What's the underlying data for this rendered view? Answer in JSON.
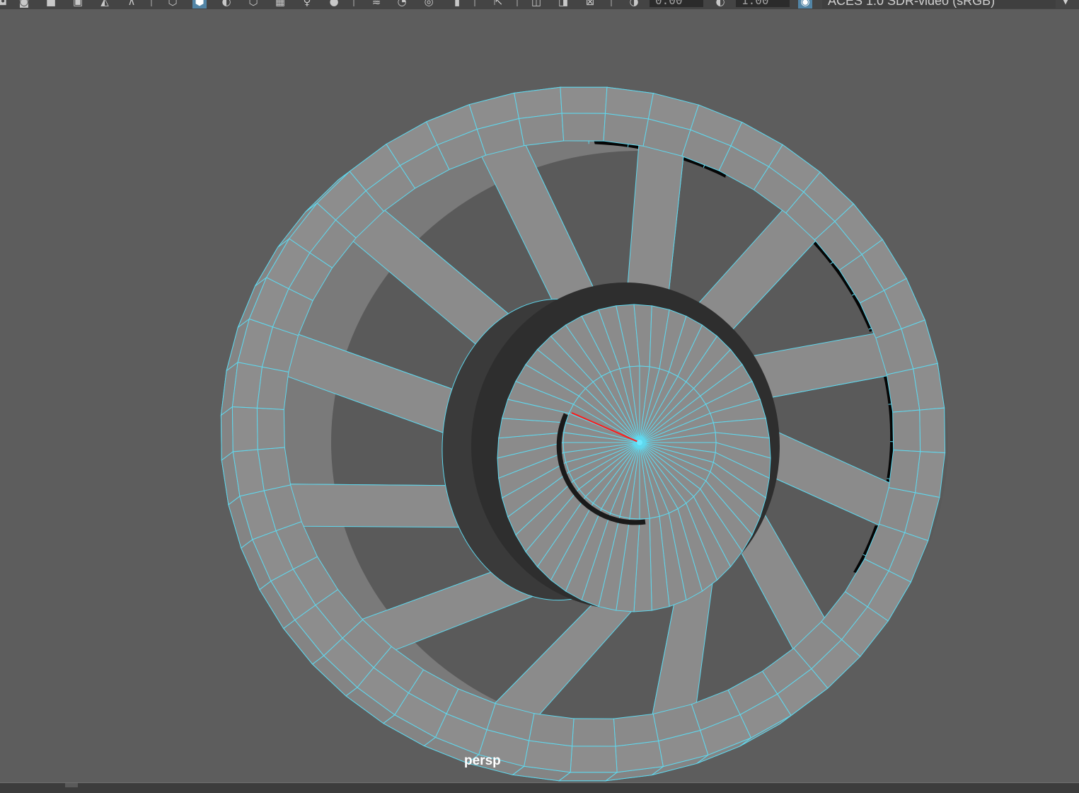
{
  "toolbar": {
    "icons": [
      {
        "name": "select-camera-icon",
        "glyph": "◘",
        "active": false
      },
      {
        "name": "camera-attributes-icon",
        "glyph": "◙",
        "active": false
      },
      {
        "name": "image-plane-icon",
        "glyph": "■",
        "active": false
      },
      {
        "name": "bookmark-icon",
        "glyph": "▣",
        "active": false
      },
      {
        "name": "2d-pan-zoom-icon",
        "glyph": "◭",
        "active": false
      },
      {
        "name": "grease-pencil-icon",
        "glyph": "⊼",
        "active": false
      },
      {
        "name": "wireframe-icon",
        "glyph": "⬡",
        "active": false
      },
      {
        "name": "smooth-shade-icon",
        "glyph": "⬢",
        "active": true
      },
      {
        "name": "default-material-icon",
        "glyph": "◐",
        "active": false
      },
      {
        "name": "wireframe-on-shaded-icon",
        "glyph": "⬡",
        "active": false
      },
      {
        "name": "textured-icon",
        "glyph": "▦",
        "active": false
      },
      {
        "name": "use-all-lights-icon",
        "glyph": "♀",
        "active": false
      },
      {
        "name": "shadows-icon",
        "glyph": "●",
        "active": false
      },
      {
        "name": "screen-space-ao-icon",
        "glyph": "≋",
        "active": false
      },
      {
        "name": "motion-blur-icon",
        "glyph": "◔",
        "active": false
      },
      {
        "name": "anti-aliasing-icon",
        "glyph": "◎",
        "active": false
      },
      {
        "name": "depth-of-field-icon",
        "glyph": "▮",
        "active": false
      },
      {
        "name": "isolate-select-icon",
        "glyph": "⇱",
        "active": false
      },
      {
        "name": "xray-icon",
        "glyph": "◫",
        "active": false
      },
      {
        "name": "xray-active-components-icon",
        "glyph": "◨",
        "active": false
      },
      {
        "name": "xray-joints-icon",
        "glyph": "⊠",
        "active": false
      },
      {
        "name": "exposure-icon",
        "glyph": "◑",
        "active": false
      },
      {
        "name": "gamma-icon",
        "glyph": "◐",
        "active": false
      },
      {
        "name": "color-management-icon",
        "glyph": "◉",
        "active": true
      }
    ],
    "exposure_value": "0.00",
    "gamma_value": "1.00",
    "color_space": "ACES 1.0 SDR-video (sRGB)"
  },
  "viewport": {
    "camera_label": "persp",
    "colors": {
      "background": "#5d5d5d",
      "wire": "#5fd8ee",
      "surface_light": "#8b8b8b",
      "surface_mid": "#6e6e6e",
      "side_dark": "#4a4a4a",
      "side_darker": "#2a2a2a",
      "hole_black": "#050505",
      "pivot": "#6fe8ff",
      "manipulator_x": "#ff1a1a"
    },
    "mesh": {
      "rim_segments": 48,
      "spoke_count": 12,
      "hub_segments": 48
    }
  }
}
